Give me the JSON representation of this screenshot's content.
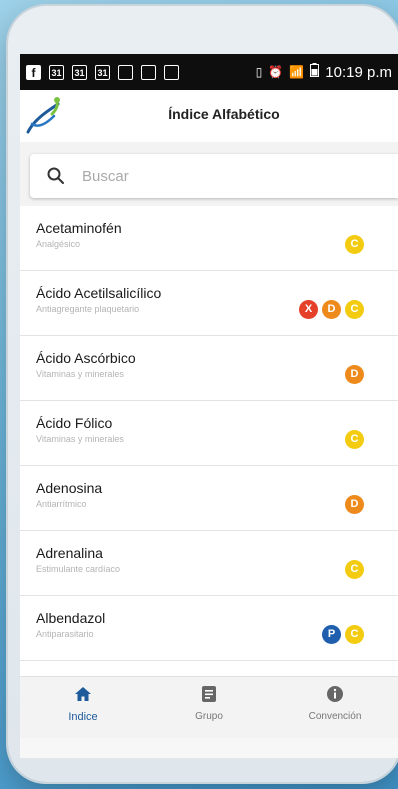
{
  "status_bar": {
    "left_icons": [
      "f",
      "31",
      "31",
      "31",
      "",
      "",
      ""
    ],
    "right_glyphs": [
      "▯",
      "⏰",
      "📶"
    ],
    "time": "10:19 p.m"
  },
  "header": {
    "title": "Índice Alfabético"
  },
  "search": {
    "placeholder": "Buscar",
    "value": ""
  },
  "drugs": [
    {
      "name": "Acetaminofén",
      "group": "Analgésico",
      "badges": [
        {
          "label": "C",
          "color": "#f3cc12"
        }
      ]
    },
    {
      "name": "Ácido Acetilsalicílico",
      "group": "Antiagregante plaquetario",
      "badges": [
        {
          "label": "X",
          "color": "#e4402a"
        },
        {
          "label": "D",
          "color": "#ee8a1c"
        },
        {
          "label": "C",
          "color": "#f3cc12"
        }
      ]
    },
    {
      "name": "Ácido Ascórbico",
      "group": "Vitaminas y minerales",
      "badges": [
        {
          "label": "D",
          "color": "#ee8a1c"
        }
      ]
    },
    {
      "name": "Ácido Fólico",
      "group": "Vitaminas y minerales",
      "badges": [
        {
          "label": "C",
          "color": "#f3cc12"
        }
      ]
    },
    {
      "name": "Adenosina",
      "group": "Antiarrítmico",
      "badges": [
        {
          "label": "D",
          "color": "#ee8a1c"
        }
      ]
    },
    {
      "name": "Adrenalina",
      "group": "Estimulante cardíaco",
      "badges": [
        {
          "label": "C",
          "color": "#f3cc12"
        }
      ]
    },
    {
      "name": "Albendazol",
      "group": "Antiparasitario",
      "badges": [
        {
          "label": "P",
          "color": "#1f5fae"
        },
        {
          "label": "C",
          "color": "#f3cc12"
        }
      ]
    }
  ],
  "nav": {
    "indice": {
      "label": "Indice",
      "icon": "home-icon"
    },
    "grupo": {
      "label": "Grupo",
      "icon": "document-icon"
    },
    "convencion": {
      "label": "Convención",
      "icon": "info-icon"
    }
  },
  "colors": {
    "accent": "#1e5b9a",
    "background": "#6bb4d9"
  }
}
